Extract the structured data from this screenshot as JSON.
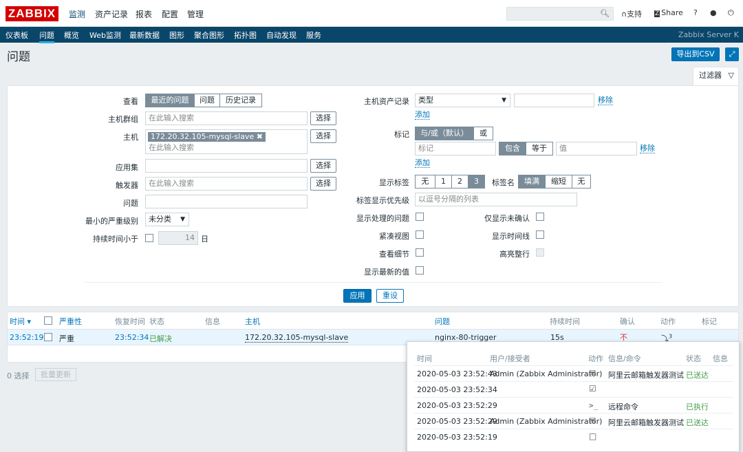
{
  "app": {
    "logo": "ZABBIX",
    "top_menu": [
      "监测",
      "资产记录",
      "报表",
      "配置",
      "管理"
    ],
    "support_label": "支持",
    "share_label": "Share",
    "help_label": "?",
    "sub_menu": [
      "仪表板",
      "问题",
      "概览",
      "Web监测",
      "最新数据",
      "图形",
      "聚合图形",
      "拓扑图",
      "自动发现",
      "服务"
    ],
    "server_name": "Zabbix Server K"
  },
  "page": {
    "title": "问题",
    "export_label": "导出到CSV",
    "filter_tab_label": "过滤器"
  },
  "filter": {
    "view_label": "查看",
    "view_options": [
      "最近的问题",
      "问题",
      "历史记录"
    ],
    "host_group_label": "主机群组",
    "host_group_placeholder": "在此输入搜索",
    "select_label": "选择",
    "host_label": "主机",
    "host_tag": "172.20.32.105-mysql-slave",
    "host_placeholder": "在此输入搜索",
    "app_label": "应用集",
    "trigger_label": "触发器",
    "trigger_placeholder": "在此输入搜索",
    "problem_label": "问题",
    "min_severity_label": "最小的严重级别",
    "min_severity_value": "未分类",
    "age_label": "持续时间小于",
    "age_value": "14",
    "age_unit": "日",
    "inventory_label": "主机资产记录",
    "inventory_type": "类型",
    "remove_label": "移除",
    "add_label": "添加",
    "tags_label": "标记",
    "tags_mode": [
      "与/或（默认）",
      "或"
    ],
    "tag_placeholder": "标记",
    "tag_operators": [
      "包含",
      "等于"
    ],
    "value_placeholder": "值",
    "show_tags_label": "显示标签",
    "show_tags_options": [
      "无",
      "1",
      "2",
      "3"
    ],
    "tag_name_label": "标签名",
    "tag_name_options": [
      "填满",
      "缩短",
      "无"
    ],
    "tag_priority_label": "标签显示优先级",
    "tag_priority_placeholder": "以逗号分隔的列表",
    "show_suppressed_label": "显示处理的问题",
    "unack_only_label": "仅显示未确认",
    "compact_label": "紧凑视图",
    "timeline_label": "显示时间线",
    "details_label": "查看细节",
    "highlight_label": "高亮整行",
    "latest_values_label": "显示最新的值",
    "apply_label": "应用",
    "reset_label": "重设"
  },
  "problems": {
    "headers": [
      "时间 ▾",
      "严重性",
      "恢复时间",
      "状态",
      "信息",
      "主机",
      "问题",
      "持续时间",
      "确认",
      "动作",
      "标记"
    ],
    "rows": [
      {
        "time": "23:52:19",
        "severity": "严重",
        "recovery_time": "23:52:34",
        "status": "已解决",
        "info": "",
        "host": "172.20.32.105-mysql-slave",
        "problem": "nginx-80-trigger",
        "duration": "15s",
        "ack": "不",
        "actions": "3"
      }
    ],
    "selected_count": "0 选择",
    "mass_update_label": "批量更新"
  },
  "action_popup": {
    "headers": [
      "时间",
      "用户/接受者",
      "动作",
      "信息/命令",
      "状态",
      "信息"
    ],
    "rows": [
      {
        "time": "2020-05-03 23:52:43",
        "user": "Admin (Zabbix Administrator)",
        "action_icon": "mail-icon",
        "message": "阿里云邮箱触发器测试",
        "status": "已送达"
      },
      {
        "time": "2020-05-03 23:52:34",
        "user": "",
        "action_icon": "calendar-check-icon",
        "message": "",
        "status": ""
      },
      {
        "time": "2020-05-03 23:52:29",
        "user": "",
        "action_icon": "terminal-icon",
        "message": "远程命令",
        "status": "已执行"
      },
      {
        "time": "2020-05-03 23:52:29",
        "user": "Admin (Zabbix Administrator)",
        "action_icon": "mail-icon",
        "message": "阿里云邮箱触发器测试",
        "status": "已送达"
      },
      {
        "time": "2020-05-03 23:52:19",
        "user": "",
        "action_icon": "calendar-icon",
        "message": "",
        "status": ""
      }
    ]
  },
  "colors": {
    "brand": "#d40000",
    "nav": "#0a466a",
    "accent": "#0275b8",
    "resolved": "#429e47",
    "not_ack": "#e33734"
  }
}
